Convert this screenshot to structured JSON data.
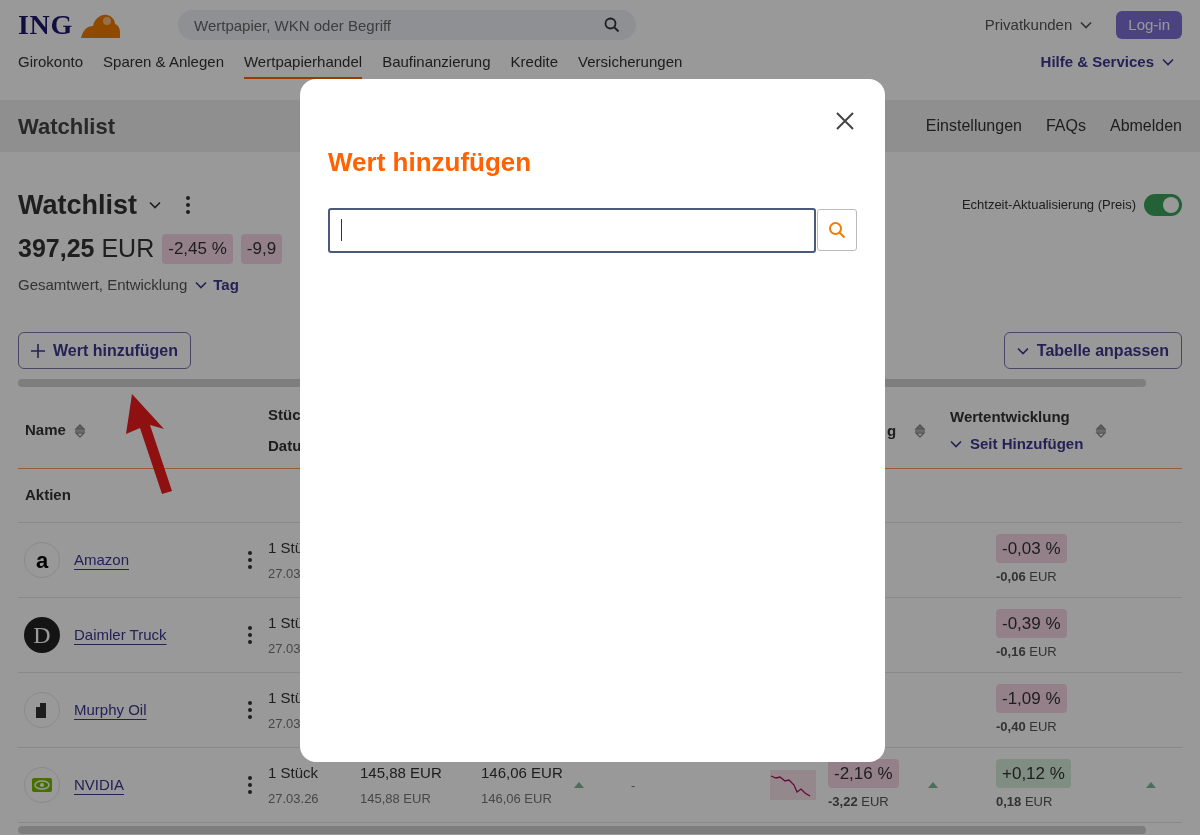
{
  "brand": {
    "name": "ING"
  },
  "search": {
    "placeholder": "Wertpapier, WKN oder Begriff"
  },
  "segment": {
    "label": "Privatkunden"
  },
  "login": {
    "label": "Log-in"
  },
  "nav": [
    {
      "label": "Girokonto",
      "selected": false
    },
    {
      "label": "Sparen & Anlegen",
      "selected": false
    },
    {
      "label": "Wertpapierhandel",
      "selected": true
    },
    {
      "label": "Baufinanzierung",
      "selected": false
    },
    {
      "label": "Kredite",
      "selected": false
    },
    {
      "label": "Versicherungen",
      "selected": false
    }
  ],
  "help": {
    "label": "Hilfe & Services"
  },
  "subnav": {
    "title": "Watchlist",
    "links": [
      "Einstellungen",
      "FAQs",
      "Abmelden"
    ]
  },
  "watchlist": {
    "title": "Watchlist",
    "total": "397,25",
    "currency": "EUR",
    "badges": [
      {
        "text": "-2,45 %",
        "positive": false
      },
      {
        "text": "-9,9",
        "positive": false
      }
    ],
    "caption": "Gesamtwert, Entwicklung",
    "period": "Tag",
    "realtime": {
      "label": "Echtzeit-Aktualisierung (Preis)",
      "on": true
    },
    "add_button": "Wert hinzufügen",
    "customize_button": "Tabelle anpassen"
  },
  "table": {
    "columns": [
      {
        "label": "Name"
      },
      {
        "label": "Stüc",
        "sublabel": "Datu"
      },
      {
        "label": "g"
      },
      {
        "label": "Wertentwicklung",
        "sublabel": "Seit Hinzufügen"
      }
    ],
    "group": "Aktien",
    "rows": [
      {
        "name": "Amazon",
        "logo": {
          "kind": "letter",
          "text": "a"
        },
        "quantity": "1 Stü",
        "date": "27.03",
        "performance": {
          "percent": "-0,03 %",
          "amount": "**-0,06** EUR",
          "positive": false
        }
      },
      {
        "name": "Daimler Truck",
        "logo": {
          "kind": "letter",
          "text": "D"
        },
        "quantity": "1 Stü",
        "date": "27.03",
        "performance": {
          "percent": "-0,39 %",
          "amount": "**-0,16** EUR",
          "positive": false
        }
      },
      {
        "name": "Murphy Oil",
        "logo": {
          "kind": "building"
        },
        "quantity": "1 Stü",
        "date": "27.03",
        "performance": {
          "percent": "-1,09 %",
          "amount": "**-0,40** EUR",
          "positive": false
        }
      },
      {
        "name": "NVIDIA",
        "logo": {
          "kind": "eye"
        },
        "quantity": "1 Stück",
        "date": "27.03.26",
        "price": {
          "value": "145,88 EUR",
          "sub": "145,88 EUR"
        },
        "price_2": {
          "value": "146,06 EUR",
          "sub": "146,06 EUR"
        },
        "column_6": "-",
        "day_change": {
          "percent": "-2,16 %",
          "amount": "**-3,22** EUR",
          "positive": false
        },
        "performance": {
          "percent": "+0,12 %",
          "amount": "**0,18** EUR",
          "positive": true
        }
      }
    ]
  },
  "modal": {
    "title": "Wert hinzufügen"
  }
}
